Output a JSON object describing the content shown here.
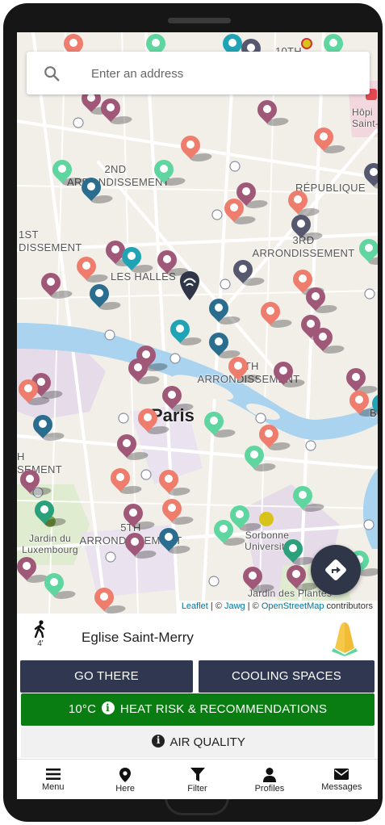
{
  "search": {
    "placeholder": "Enter an address"
  },
  "map": {
    "labels": {
      "tenth": "10TH",
      "second": "2ND ARRONDISSEMENT",
      "second_line1": "2ND",
      "second_line2": "ARRONDISSEMENT",
      "republique": "RÉPUBLIQUE",
      "first_line1": "1ST",
      "first_line2": "DISSEMENT",
      "third_line1": "3RD",
      "third_line2": "ARRONDISSEMENT",
      "les_halles": "LES HALLES",
      "fourth_line1": "4TH",
      "fourth_line2": "ARRONDISSEMENT",
      "paris": "Paris",
      "sixth_line1": "H",
      "sixth_line2": "SEMENT",
      "fifth_line1": "5TH",
      "fifth_line2": "ARRONDISSEMENT",
      "jardin_lux_line1": "Jardin du",
      "jardin_lux_line2": "Luxembourg",
      "sorbonne_line1": "Sorbonne",
      "sorbonne_line2": "University",
      "jardin_plantes": "Jardin des Plantes",
      "hopital_line1": "Hôpi",
      "hopital_line2": "Saint-L",
      "b": "B"
    },
    "attribution": {
      "leaflet": "Leaflet",
      "sep1": " | © ",
      "jawg": "Jawg",
      "sep2": " | © ",
      "osm": "OpenStreetMap",
      "suffix": " contributors"
    },
    "pin_colors": {
      "salmon": "#ee7d6e",
      "mauve": "#a05878",
      "mint": "#5fd6a0",
      "teal": "#2a6d8e",
      "cyan": "#1fa3b5",
      "slate": "#55586e",
      "green": "#2aa17a"
    }
  },
  "panel": {
    "walk_time": "4'",
    "place_name": "Eglise Saint-Merry",
    "go_there": "GO THERE",
    "cooling_spaces": "COOLING SPACES",
    "heat_temp": "10°C",
    "heat_label": "HEAT RISK & RECOMMENDATIONS",
    "air_quality": "AIR QUALITY"
  },
  "nav": {
    "menu": "Menu",
    "here": "Here",
    "filter": "Filter",
    "profiles": "Profiles",
    "messages": "Messages"
  }
}
